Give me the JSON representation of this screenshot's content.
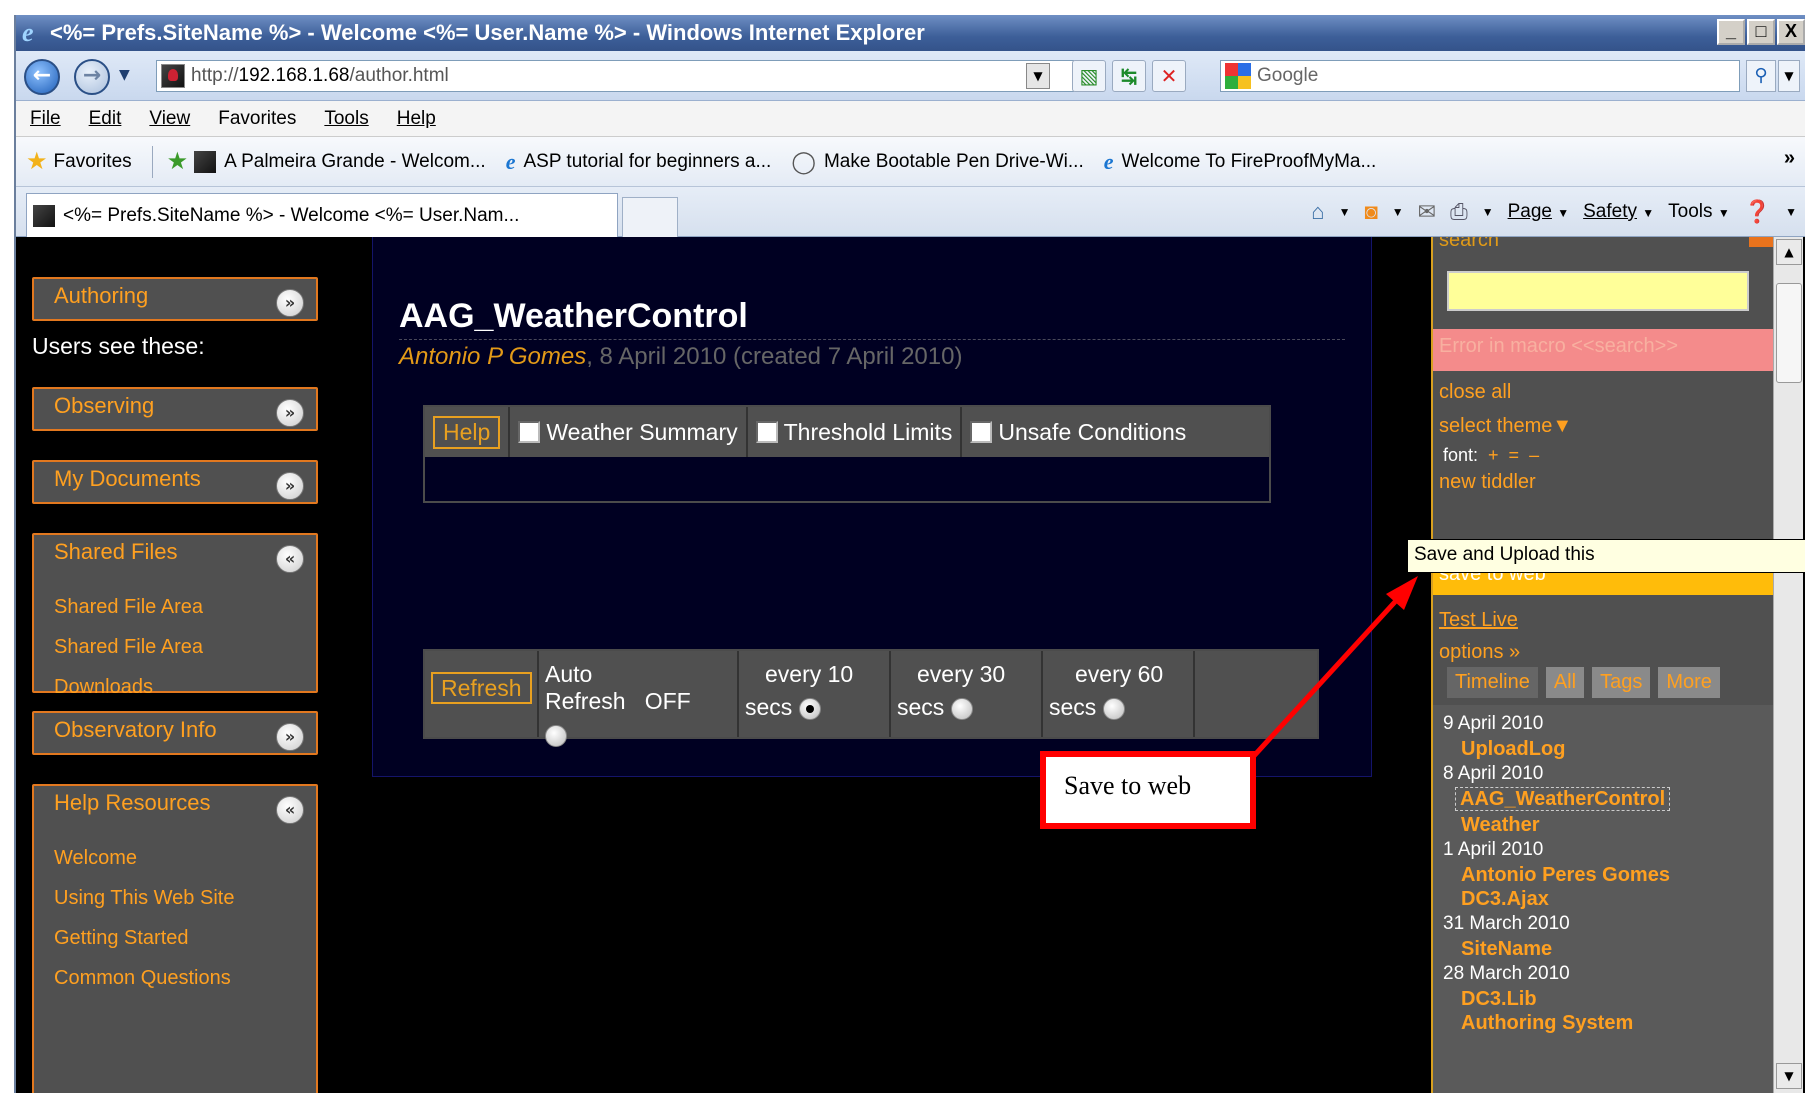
{
  "window": {
    "title": "<%= Prefs.SiteName %> - Welcome <%= User.Name %> - Windows Internet Explorer",
    "minimize": "_",
    "maximize": "□",
    "close": "X"
  },
  "address": {
    "url_prefix": "http://",
    "url_host": "192.168.1.68",
    "url_path": "/author.html",
    "search_placeholder": "Google"
  },
  "menu": [
    "File",
    "Edit",
    "View",
    "Favorites",
    "Tools",
    "Help"
  ],
  "favorites_bar": {
    "favorites_label": "Favorites",
    "items": [
      "A Palmeira Grande - Welcom...",
      "ASP tutorial for beginners a...",
      "Make Bootable Pen Drive-Wi...",
      "Welcome To FireProofMyMa..."
    ],
    "overflow": "»"
  },
  "tab": {
    "label": "<%= Prefs.SiteName %> - Welcome <%= User.Nam..."
  },
  "command_bar": {
    "page": "Page",
    "safety": "Safety",
    "tools": "Tools"
  },
  "left_sidebar": {
    "authoring": "Authoring",
    "users_see": "Users see these:",
    "observing": "Observing",
    "my_documents": "My Documents",
    "shared_files": "Shared Files",
    "shared_links": [
      "Shared File Area",
      "Shared File Area",
      "Downloads"
    ],
    "observatory_info": "Observatory Info",
    "help_resources": "Help Resources",
    "help_links": [
      "Welcome",
      "Using This Web Site",
      "Getting Started",
      "Common Questions"
    ]
  },
  "tiddler": {
    "title": "AAG_WeatherControl",
    "author": "Antonio P Gomes",
    "meta": ", 8 April 2010 (created 7 April 2010)"
  },
  "controls": {
    "help": "Help",
    "weather_summary": "Weather Summary",
    "threshold_limits": "Threshold Limits",
    "unsafe_conditions": "Unsafe Conditions",
    "refresh": "Refresh",
    "auto_refresh": "Auto Refresh",
    "off": "OFF",
    "every_10": "every 10",
    "every_30": "every 30",
    "every_60": "every 60",
    "secs": "secs",
    "selected_interval": "every 10"
  },
  "right_sidebar": {
    "search_label": "search",
    "error": "Error in macro <<search>>",
    "close_all": "close all",
    "select_theme": "select theme▼",
    "font_label": "font:",
    "font_plus": "+",
    "font_equal": "=",
    "font_minus": "–",
    "new_tiddler": "new tiddler",
    "save_to_web": "save to web",
    "test_live": "Test Live",
    "options": "options »",
    "tabs": [
      "Timeline",
      "All",
      "Tags",
      "More"
    ],
    "timeline": [
      {
        "date": "9 April 2010",
        "items": [
          "UploadLog"
        ]
      },
      {
        "date": "8 April 2010",
        "items": [
          "AAG_WeatherControl",
          "Weather"
        ]
      },
      {
        "date": "1 April 2010",
        "items": [
          "Antonio Peres Gomes",
          "DC3.Ajax"
        ]
      },
      {
        "date": "31 March 2010",
        "items": [
          "SiteName"
        ]
      },
      {
        "date": "28 March 2010",
        "items": [
          "DC3.Lib",
          "Authoring System"
        ]
      }
    ]
  },
  "tooltip": "Save and Upload this",
  "callout": "Save to web",
  "colors": {
    "accent": "#ffa020",
    "callout_red": "#ff0000",
    "highlight": "#ffbc0a"
  }
}
